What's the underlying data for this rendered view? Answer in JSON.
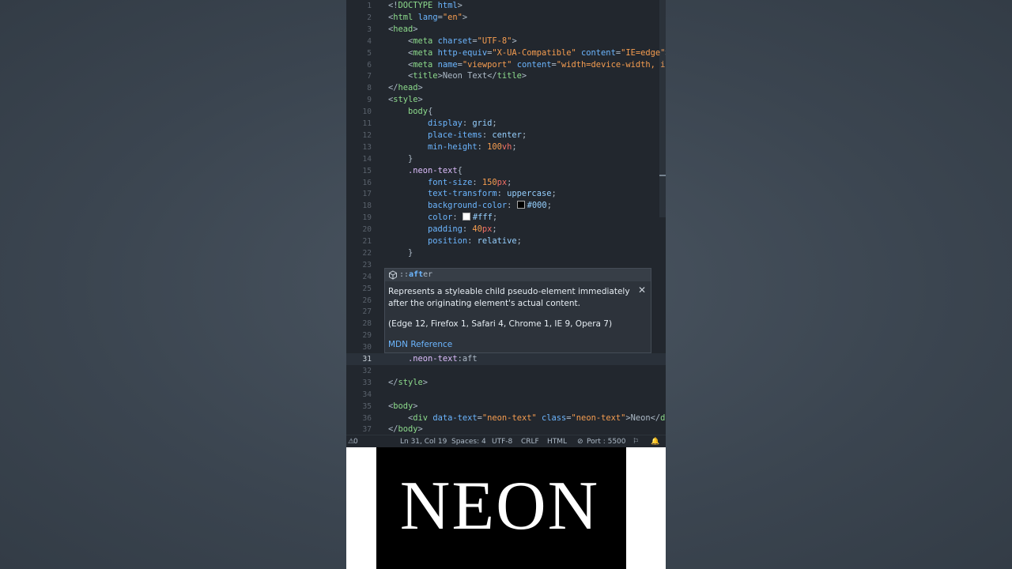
{
  "editor": {
    "lines": [
      {
        "n": "1",
        "tokens": [
          [
            "t-punc",
            "<!"
          ],
          [
            "t-tag",
            "DOCTYPE"
          ],
          [
            "t-punc",
            " "
          ],
          [
            "t-attr",
            "html"
          ],
          [
            "t-punc",
            ">"
          ]
        ]
      },
      {
        "n": "2",
        "tokens": [
          [
            "t-punc",
            "<"
          ],
          [
            "t-tag",
            "html"
          ],
          [
            "t-punc",
            " "
          ],
          [
            "t-attr",
            "lang"
          ],
          [
            "t-punc",
            "="
          ],
          [
            "t-str",
            "\"en\""
          ],
          [
            "t-punc",
            ">"
          ]
        ]
      },
      {
        "n": "3",
        "tokens": [
          [
            "t-punc",
            "<"
          ],
          [
            "t-tag",
            "head"
          ],
          [
            "t-punc",
            ">"
          ]
        ]
      },
      {
        "n": "4",
        "tokens": [
          [
            "t-punc",
            "    <"
          ],
          [
            "t-tag",
            "meta"
          ],
          [
            "t-punc",
            " "
          ],
          [
            "t-attr",
            "charset"
          ],
          [
            "t-punc",
            "="
          ],
          [
            "t-str",
            "\"UTF-8\""
          ],
          [
            "t-punc",
            ">"
          ]
        ]
      },
      {
        "n": "5",
        "tokens": [
          [
            "t-punc",
            "    <"
          ],
          [
            "t-tag",
            "meta"
          ],
          [
            "t-punc",
            " "
          ],
          [
            "t-attr",
            "http-equiv"
          ],
          [
            "t-punc",
            "="
          ],
          [
            "t-str",
            "\"X-UA-Compatible\""
          ],
          [
            "t-punc",
            " "
          ],
          [
            "t-attr",
            "content"
          ],
          [
            "t-punc",
            "="
          ],
          [
            "t-str",
            "\"IE=edge\""
          ],
          [
            "t-punc",
            ">"
          ]
        ]
      },
      {
        "n": "6",
        "tokens": [
          [
            "t-punc",
            "    <"
          ],
          [
            "t-tag",
            "meta"
          ],
          [
            "t-punc",
            " "
          ],
          [
            "t-attr",
            "name"
          ],
          [
            "t-punc",
            "="
          ],
          [
            "t-str",
            "\"viewport\""
          ],
          [
            "t-punc",
            " "
          ],
          [
            "t-attr",
            "content"
          ],
          [
            "t-punc",
            "="
          ],
          [
            "t-str",
            "\"width=device-width, init"
          ]
        ]
      },
      {
        "n": "7",
        "tokens": [
          [
            "t-punc",
            "    <"
          ],
          [
            "t-tag",
            "title"
          ],
          [
            "t-punc",
            ">Neon Text</"
          ],
          [
            "t-tag",
            "title"
          ],
          [
            "t-punc",
            ">"
          ]
        ]
      },
      {
        "n": "8",
        "tokens": [
          [
            "t-punc",
            "</"
          ],
          [
            "t-tag",
            "head"
          ],
          [
            "t-punc",
            ">"
          ]
        ]
      },
      {
        "n": "9",
        "tokens": [
          [
            "t-punc",
            "<"
          ],
          [
            "t-tag",
            "style"
          ],
          [
            "t-punc",
            ">"
          ]
        ]
      },
      {
        "n": "10",
        "tokens": [
          [
            "t-punc",
            "    "
          ],
          [
            "t-sel",
            "body"
          ],
          [
            "t-punc",
            "{"
          ]
        ]
      },
      {
        "n": "11",
        "tokens": [
          [
            "t-punc",
            "        "
          ],
          [
            "t-prop",
            "display"
          ],
          [
            "t-punc",
            ": "
          ],
          [
            "t-val",
            "grid"
          ],
          [
            "t-punc",
            ";"
          ]
        ]
      },
      {
        "n": "12",
        "tokens": [
          [
            "t-punc",
            "        "
          ],
          [
            "t-prop",
            "place-items"
          ],
          [
            "t-punc",
            ": "
          ],
          [
            "t-val",
            "center"
          ],
          [
            "t-punc",
            ";"
          ]
        ]
      },
      {
        "n": "13",
        "tokens": [
          [
            "t-punc",
            "        "
          ],
          [
            "t-prop",
            "min-height"
          ],
          [
            "t-punc",
            ": "
          ],
          [
            "t-num",
            "100"
          ],
          [
            "t-unit",
            "vh"
          ],
          [
            "t-punc",
            ";"
          ]
        ]
      },
      {
        "n": "14",
        "tokens": [
          [
            "t-punc",
            "    }"
          ]
        ]
      },
      {
        "n": "15",
        "tokens": [
          [
            "t-punc",
            "    "
          ],
          [
            "t-cls",
            ".neon-text"
          ],
          [
            "t-punc",
            "{"
          ]
        ]
      },
      {
        "n": "16",
        "tokens": [
          [
            "t-punc",
            "        "
          ],
          [
            "t-prop",
            "font-size"
          ],
          [
            "t-punc",
            ": "
          ],
          [
            "t-num",
            "150"
          ],
          [
            "t-unit",
            "px"
          ],
          [
            "t-punc",
            ";"
          ]
        ]
      },
      {
        "n": "17",
        "tokens": [
          [
            "t-punc",
            "        "
          ],
          [
            "t-prop",
            "text-transform"
          ],
          [
            "t-punc",
            ": "
          ],
          [
            "t-val",
            "uppercase"
          ],
          [
            "t-punc",
            ";"
          ]
        ]
      },
      {
        "n": "18",
        "tokens": [
          [
            "t-punc",
            "        "
          ],
          [
            "t-prop",
            "background-color"
          ],
          [
            "t-punc",
            ": "
          ],
          [
            "swatch-000",
            ""
          ],
          [
            "t-val",
            "#000"
          ],
          [
            "t-punc",
            ";"
          ]
        ]
      },
      {
        "n": "19",
        "tokens": [
          [
            "t-punc",
            "        "
          ],
          [
            "t-prop",
            "color"
          ],
          [
            "t-punc",
            ": "
          ],
          [
            "swatch-fff",
            ""
          ],
          [
            "t-val",
            "#fff"
          ],
          [
            "t-punc",
            ";"
          ]
        ]
      },
      {
        "n": "20",
        "tokens": [
          [
            "t-punc",
            "        "
          ],
          [
            "t-prop",
            "padding"
          ],
          [
            "t-punc",
            ": "
          ],
          [
            "t-num",
            "40"
          ],
          [
            "t-unit",
            "px"
          ],
          [
            "t-punc",
            ";"
          ]
        ]
      },
      {
        "n": "21",
        "tokens": [
          [
            "t-punc",
            "        "
          ],
          [
            "t-prop",
            "position"
          ],
          [
            "t-punc",
            ": "
          ],
          [
            "t-val",
            "relative"
          ],
          [
            "t-punc",
            ";"
          ]
        ]
      },
      {
        "n": "22",
        "tokens": [
          [
            "t-punc",
            "    }"
          ]
        ]
      },
      {
        "n": "23",
        "tokens": []
      },
      {
        "n": "24",
        "tokens": []
      },
      {
        "n": "25",
        "tokens": []
      },
      {
        "n": "26",
        "tokens": []
      },
      {
        "n": "27",
        "tokens": []
      },
      {
        "n": "28",
        "tokens": []
      },
      {
        "n": "29",
        "tokens": []
      },
      {
        "n": "30",
        "tokens": []
      },
      {
        "n": "31",
        "tokens": [
          [
            "t-punc",
            "    "
          ],
          [
            "t-cls",
            ".neon-text"
          ],
          [
            "t-punc",
            ":aft"
          ]
        ],
        "active": true
      },
      {
        "n": "32",
        "tokens": []
      },
      {
        "n": "33",
        "tokens": [
          [
            "t-punc",
            "</"
          ],
          [
            "t-tag",
            "style"
          ],
          [
            "t-punc",
            ">"
          ]
        ]
      },
      {
        "n": "34",
        "tokens": []
      },
      {
        "n": "35",
        "tokens": [
          [
            "t-punc",
            "<"
          ],
          [
            "t-tag",
            "body"
          ],
          [
            "t-punc",
            ">"
          ]
        ]
      },
      {
        "n": "36",
        "tokens": [
          [
            "t-punc",
            "    <"
          ],
          [
            "t-tag",
            "div"
          ],
          [
            "t-punc",
            " "
          ],
          [
            "t-attr",
            "data-text"
          ],
          [
            "t-punc",
            "="
          ],
          [
            "t-str",
            "\"neon-text\""
          ],
          [
            "t-punc",
            " "
          ],
          [
            "t-attr",
            "class"
          ],
          [
            "t-punc",
            "="
          ],
          [
            "t-str",
            "\"neon-text\""
          ],
          [
            "t-punc",
            ">Neon</"
          ],
          [
            "t-tag",
            "div"
          ]
        ]
      },
      {
        "n": "37",
        "tokens": [
          [
            "t-punc",
            "</"
          ],
          [
            "t-tag",
            "body"
          ],
          [
            "t-punc",
            ">"
          ]
        ]
      }
    ]
  },
  "suggest": {
    "prefix": "::",
    "match": "aft",
    "rest": "er",
    "description": "Represents a styleable child pseudo-element immediately after the originating element's actual content.",
    "compat": "(Edge 12, Firefox 1, Safari 4, Chrome 1, IE 9, Opera 7)",
    "mdn": "MDN Reference",
    "close": "✕"
  },
  "status": {
    "problems": "0",
    "position": "Ln 31, Col 19",
    "spaces": "Spaces: 4",
    "encoding": "UTF-8",
    "eol": "CRLF",
    "language": "HTML",
    "port": "Port : 5500"
  },
  "preview": {
    "text": "NEON"
  },
  "colors": {
    "editor_bg": "#22272e",
    "accent": "#6cb6ff"
  }
}
